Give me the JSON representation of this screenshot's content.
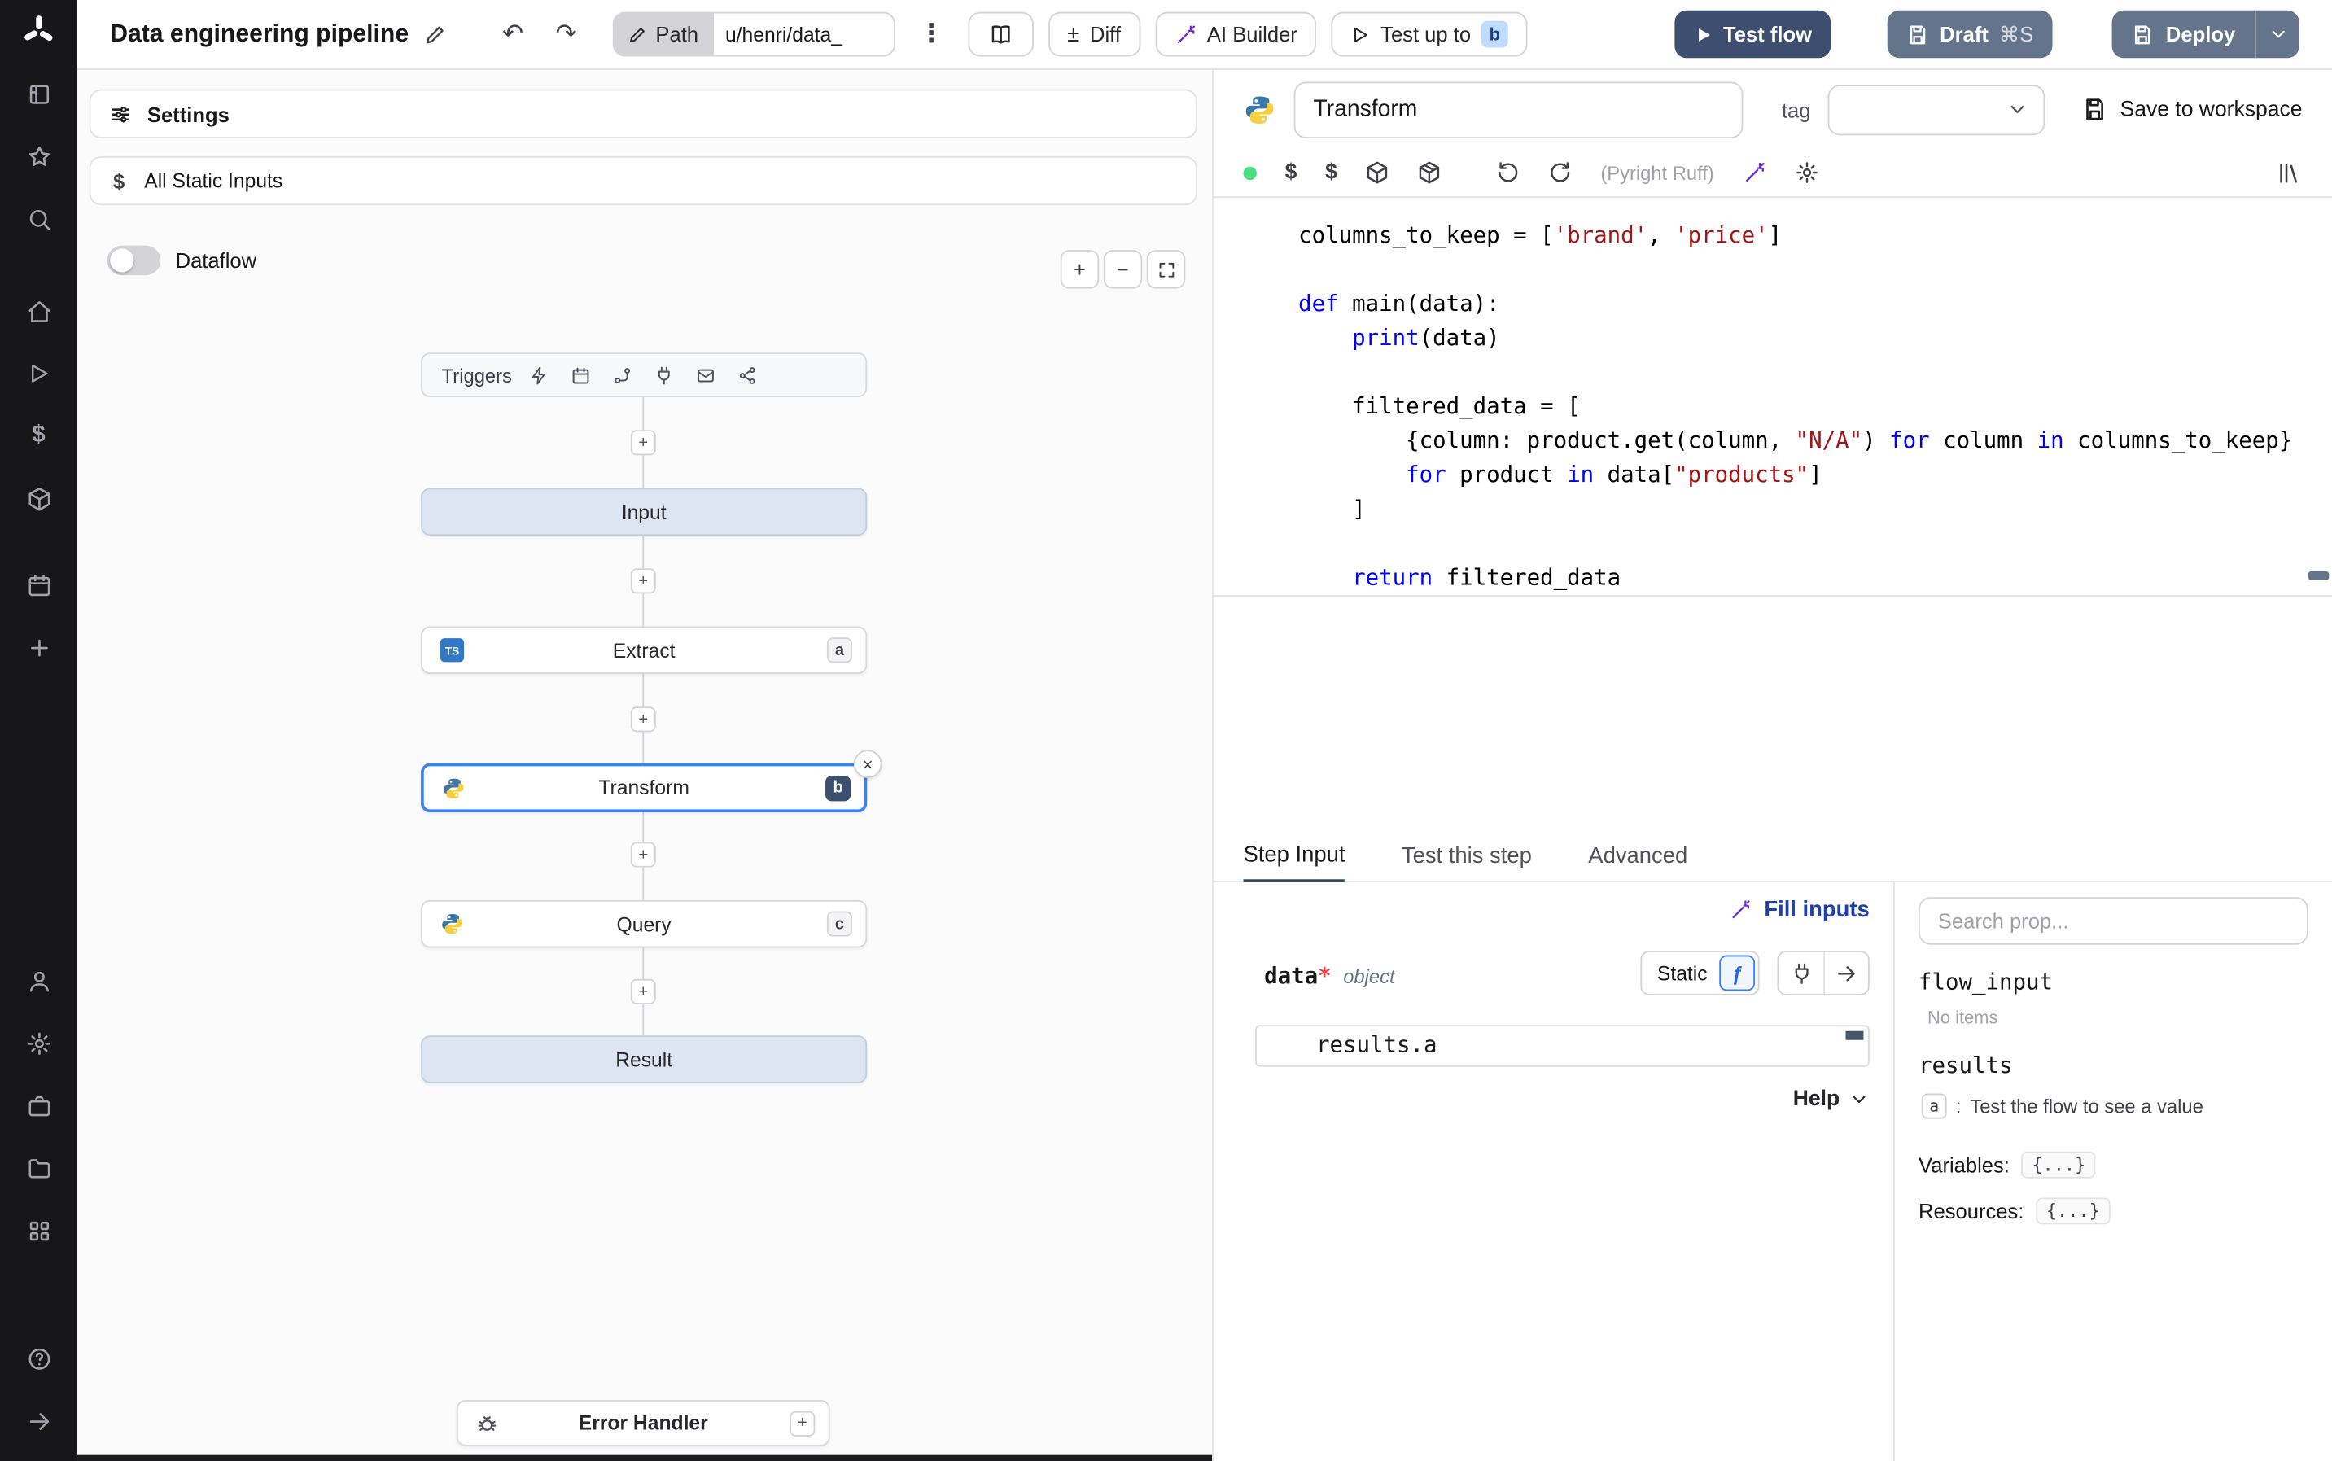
{
  "icons": {
    "plus": "+",
    "minus": "−",
    "close": "×",
    "kebab": "⋮",
    "undo": "↶",
    "redo": "↷",
    "plusminus": "±",
    "dollar": "$",
    "sparkle": "✦",
    "fx": "ƒ",
    "colon": ":"
  },
  "sidebar_icons": [
    "windmill-logo",
    "apps-icon",
    "favorites-icon",
    "search-icon",
    "home-icon",
    "runs-icon",
    "variables-icon",
    "resources-icon",
    "schedules-icon",
    "create-icon",
    "user-icon",
    "settings-icon",
    "workers-icon",
    "folders-icon",
    "apps-grid-icon",
    "help-icon",
    "collapse-sidebar-icon"
  ],
  "topbar": {
    "title": "Data engineering pipeline",
    "path_button": "Path",
    "path_value": "u/henri/data_",
    "diff": "Diff",
    "ai_builder": "AI Builder",
    "test_up_to": "Test up to",
    "test_up_to_badge": "b",
    "test_flow": "Test flow",
    "draft": "Draft",
    "draft_shortcut": "⌘S",
    "deploy": "Deploy"
  },
  "flow_panel": {
    "settings": "Settings",
    "all_static_inputs": "All Static Inputs",
    "dataflow": "Dataflow",
    "triggers_label": "Triggers",
    "nodes": {
      "input": "Input",
      "extract": {
        "label": "Extract",
        "badge": "a",
        "lang": "TS"
      },
      "transform": {
        "label": "Transform",
        "badge": "b"
      },
      "query": {
        "label": "Query",
        "badge": "c"
      },
      "result": "Result",
      "error_handler": "Error Handler"
    }
  },
  "editor_panel": {
    "step_name": "Transform",
    "tag_label": "tag",
    "save_to_workspace": "Save to workspace",
    "lint": "(Pyright Ruff)",
    "code": [
      [
        {
          "t": "d",
          "x": "columns_to_keep = ["
        },
        {
          "t": "s",
          "x": "'brand'"
        },
        {
          "t": "d",
          "x": ", "
        },
        {
          "t": "s",
          "x": "'price'"
        },
        {
          "t": "d",
          "x": "]"
        }
      ],
      [],
      [
        {
          "t": "k",
          "x": "def"
        },
        {
          "t": "d",
          "x": " main(data):"
        }
      ],
      [
        {
          "t": "d",
          "x": "    "
        },
        {
          "t": "k",
          "x": "print"
        },
        {
          "t": "d",
          "x": "(data)"
        }
      ],
      [],
      [
        {
          "t": "d",
          "x": "    filtered_data = ["
        }
      ],
      [
        {
          "t": "d",
          "x": "        {column: product.get(column, "
        },
        {
          "t": "s",
          "x": "\"N/A\""
        },
        {
          "t": "d",
          "x": ") "
        },
        {
          "t": "k",
          "x": "for"
        },
        {
          "t": "d",
          "x": " column "
        },
        {
          "t": "k",
          "x": "in"
        },
        {
          "t": "d",
          "x": " columns_to_keep}"
        }
      ],
      [
        {
          "t": "d",
          "x": "        "
        },
        {
          "t": "k",
          "x": "for"
        },
        {
          "t": "d",
          "x": " product "
        },
        {
          "t": "k",
          "x": "in"
        },
        {
          "t": "d",
          "x": " data["
        },
        {
          "t": "s",
          "x": "\"products\""
        },
        {
          "t": "d",
          "x": "]"
        }
      ],
      [
        {
          "t": "d",
          "x": "    ]"
        }
      ],
      [],
      [
        {
          "t": "d",
          "x": "    "
        },
        {
          "t": "k",
          "x": "return"
        },
        {
          "t": "d",
          "x": " filtered_data"
        }
      ]
    ]
  },
  "bottom_panel": {
    "tabs": [
      "Step Input",
      "Test this step",
      "Advanced"
    ],
    "fill_inputs": "Fill inputs",
    "arg_name": "data",
    "arg_required": "*",
    "arg_type": "object",
    "static_label": "Static",
    "input_value": "results.a",
    "help": "Help"
  },
  "prop_picker": {
    "search_placeholder": "Search prop...",
    "flow_input_label": "flow_input",
    "no_items": "No items",
    "results_label": "results",
    "result_key": "a",
    "result_separator": ":",
    "result_hint": "Test the flow to see a value",
    "variables_label": "Variables:",
    "variables_value": "{...}",
    "resources_label": "Resources:",
    "resources_value": "{...}"
  }
}
